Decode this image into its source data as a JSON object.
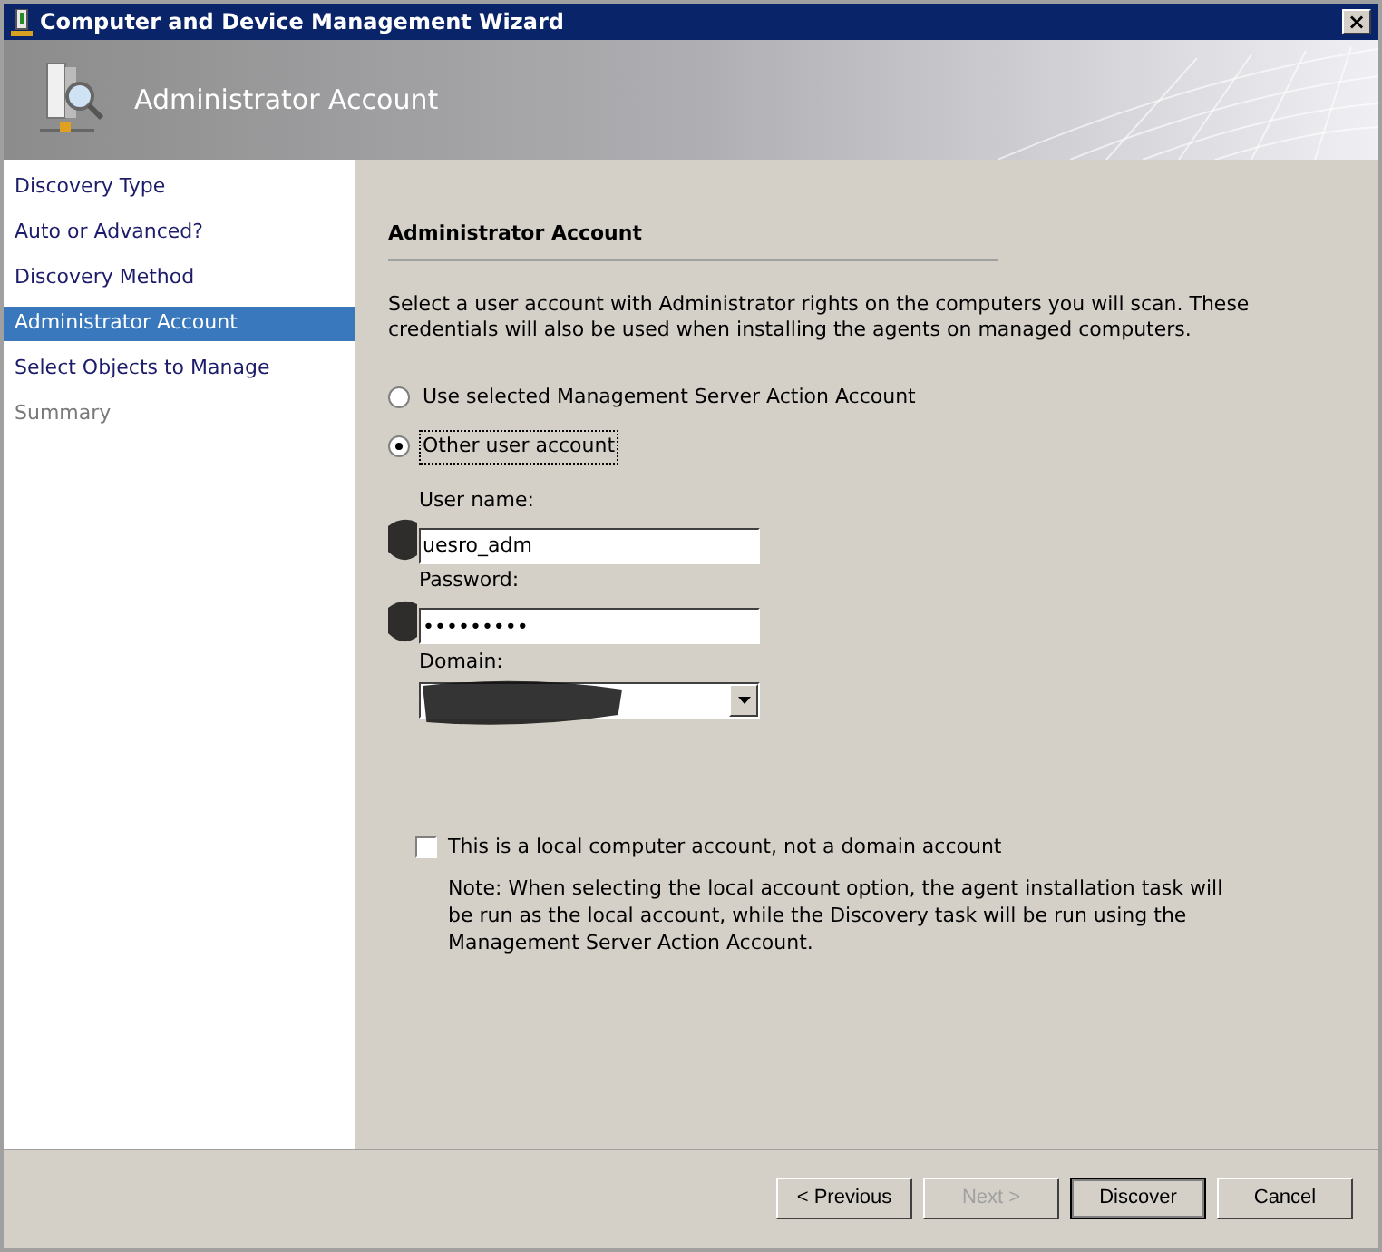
{
  "window": {
    "title": "Computer and Device Management Wizard",
    "close_label": "×"
  },
  "header": {
    "title": "Administrator Account"
  },
  "sidebar": {
    "items": [
      {
        "label": "Discovery Type",
        "selected": false,
        "disabled": false
      },
      {
        "label": "Auto or Advanced?",
        "selected": false,
        "disabled": false
      },
      {
        "label": "Discovery Method",
        "selected": false,
        "disabled": false
      },
      {
        "label": "Administrator Account",
        "selected": true,
        "disabled": false
      },
      {
        "label": "Select Objects to Manage",
        "selected": false,
        "disabled": false
      },
      {
        "label": "Summary",
        "selected": false,
        "disabled": true
      }
    ]
  },
  "content": {
    "heading": "Administrator Account",
    "description": "Select a user account with Administrator rights on the computers you will scan. These credentials will also be used when installing the agents on managed computers.",
    "account_options": [
      {
        "label": "Use selected Management Server Action Account",
        "selected": false
      },
      {
        "label": "Other user account",
        "selected": true
      }
    ],
    "fields": [
      {
        "kind": "text",
        "label": "User name:",
        "value": "uesro_adm"
      },
      {
        "kind": "password",
        "label": "Password:",
        "value": "•••••••••"
      },
      {
        "kind": "dropdown",
        "label": "Domain:"
      }
    ],
    "local_account": {
      "label": "This is a local computer account, not a domain account",
      "checked": false
    },
    "note": "Note:  When selecting the local account option, the agent installation task will be run as the local account, while the Discovery task will be run using the Management Server Action Account."
  },
  "buttons": [
    {
      "label": "< Previous",
      "disabled": false,
      "default": false
    },
    {
      "label": "Next >",
      "disabled": true,
      "default": false
    },
    {
      "label": "Discover",
      "disabled": false,
      "default": true
    },
    {
      "label": "Cancel",
      "disabled": false,
      "default": false
    }
  ]
}
